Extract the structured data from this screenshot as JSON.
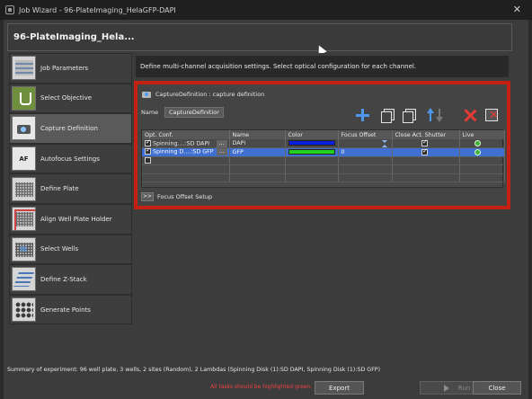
{
  "window": {
    "title": "Job Wizard - 96-PlateImaging_HelaGFP-DAPI",
    "close_glyph": "✕"
  },
  "header": {
    "project_name": "96-PlateImaging_Hela..."
  },
  "sidebar": {
    "items": [
      {
        "label": "Job Parameters",
        "icon": "job-parameters-icon"
      },
      {
        "label": "Select Objective",
        "icon": "objective-icon"
      },
      {
        "label": "Capture Definition",
        "icon": "camera-icon",
        "active": true
      },
      {
        "label": "Autofocus Settings",
        "icon": "autofocus-icon",
        "icon_text": "AF"
      },
      {
        "label": "Define Plate",
        "icon": "plate-icon"
      },
      {
        "label": "Align Well Plate Holder",
        "icon": "align-plate-icon"
      },
      {
        "label": "Select Wells",
        "icon": "select-wells-icon"
      },
      {
        "label": "Define Z-Stack",
        "icon": "z-stack-icon"
      },
      {
        "label": "Generate Points",
        "icon": "points-icon"
      }
    ]
  },
  "content": {
    "info": "Define multi-channel acquisition settings. Select optical configuration for each channel.",
    "capture": {
      "header": "CaptureDefinition : capture definition",
      "name_label": "Name",
      "name_value": "CaptureDefinition",
      "columns": [
        "Opt. Conf.",
        "Name",
        "Color",
        "Focus Offset",
        "Close Act. Shutter",
        "Live"
      ],
      "rows": [
        {
          "opt_conf": "Spinning....:SD DAPI",
          "checked": true,
          "name": "DAPI",
          "color": "#0a1fe0",
          "focus_offset": "",
          "close_shutter": true,
          "live": true,
          "selected": false
        },
        {
          "opt_conf": "Spinning D....:SD GFP",
          "checked": true,
          "name": "GFP",
          "color": "#22d21f",
          "focus_offset": "0",
          "close_shutter": true,
          "live": true,
          "selected": true
        }
      ],
      "browse_label": "...",
      "focus_setup_button": ">>",
      "focus_setup_label": "Focus Offset Setup"
    }
  },
  "footer": {
    "summary": "Summary of experiment: 96 well plate, 3 wells, 2 sites (Random), 2 Lambdas (Spinning Disk (1):SD DAPI, Spinning Disk (1):SD GFP)",
    "warning": "All tasks should be highlighted green.",
    "export_label": "Export",
    "run_label": "Run",
    "close_label": "Close"
  },
  "colors": {
    "accent_red": "#c42112",
    "selection_blue": "#3f6fd1",
    "toolbar_blue": "#4d98ea"
  }
}
